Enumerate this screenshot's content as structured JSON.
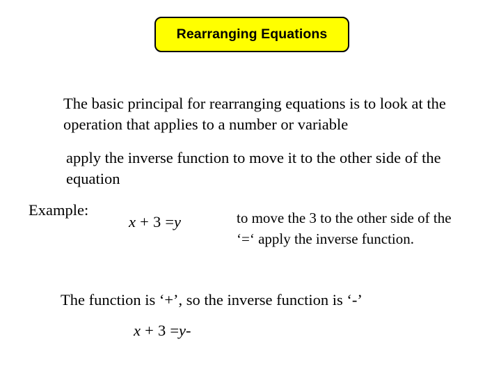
{
  "slide": {
    "background_color": "#ffffff",
    "text_color": "#000000"
  },
  "title": {
    "text": "Rearranging Equations",
    "fill_color": "#ffff00",
    "border_color": "#000000"
  },
  "body": {
    "paragraph_1": "The basic principal for rearranging equations is to look at the operation that applies to a number or variable",
    "paragraph_2": "apply the inverse function to move it to the other side of the equation",
    "example_label": "Example:",
    "paragraph_3": "to move the 3 to the other side of the ‘=‘ apply the inverse function.",
    "paragraph_4": "The function is ‘+’, so the inverse function is ‘-’"
  },
  "equations": {
    "equation_1": {
      "full": "x + 3 = y",
      "lhs_var": "x",
      "plus": "+",
      "number": "3",
      "equals": "=",
      "rhs_var": "y"
    },
    "equation_2": {
      "full": "x + 3 = y-",
      "lhs_var": "x",
      "plus": "+",
      "number": "3",
      "equals": "=",
      "rhs_var": "y",
      "minus": "-"
    }
  }
}
